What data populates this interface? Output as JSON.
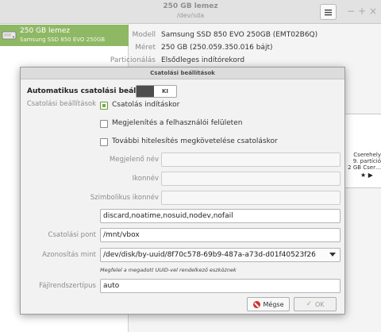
{
  "window": {
    "title": "250 GB lemez",
    "subtitle": "/dev/sda",
    "menu_icon": "hamburger-menu-icon",
    "minimize": "−",
    "maximize": "+",
    "close": "×"
  },
  "sidebar": {
    "items": [
      {
        "name": "250 GB lemez",
        "model": "Samsung SSD 850 EVO 250GB",
        "icon": "drive-icon"
      }
    ]
  },
  "properties": [
    {
      "key": "Modell",
      "value": "Samsung SSD 850 EVO 250GB (EMT02B6Q)"
    },
    {
      "key": "Méret",
      "value": "250 GB (250.059.350.016 bájt)"
    },
    {
      "key": "Particionálás",
      "value": "Elsődleges indítórekord"
    }
  ],
  "volume": {
    "label1": "Cserehely",
    "label2": "9. partíció",
    "label3": "2 GB Cser…",
    "icons": "★ ▶"
  },
  "dialog": {
    "title": "Csatolási beállítások",
    "auto_label": "Automatikus csatolási beállítások",
    "toggle_text": "KI",
    "section_label": "Csatolási beállítások",
    "checkboxes": [
      {
        "label": "Csatolás indításkor",
        "checked": true
      },
      {
        "label": "Megjelenítés a felhasználói felületen",
        "checked": false
      },
      {
        "label": "További hitelesítés megkövetelése csatoláskor",
        "checked": false
      }
    ],
    "display_name_label": "Megjelenő név",
    "display_name_value": "",
    "icon_label": "Ikonnév",
    "icon_value": "",
    "symbolic_icon_label": "Szimbolikus ikonnév",
    "symbolic_icon_value": "",
    "options_value": "discard,noatime,nosuid,nodev,nofail",
    "mount_point_label": "Csatolási pont",
    "mount_point_value": "/mnt/vbox",
    "identify_label": "Azonosítás mint",
    "identify_value": "/dev/disk/by-uuid/8f70c578-69b9-487a-a73d-d01f40523f26",
    "identify_hint": "Megfelel a megadott UUID-vel rendelkező eszköznek",
    "fstype_label": "Fájlrendszertípus",
    "fstype_value": "auto",
    "cancel_label": "Mégse",
    "ok_label": "OK"
  },
  "colors": {
    "accent": "#8fb865",
    "cancel": "#d22f2f"
  }
}
